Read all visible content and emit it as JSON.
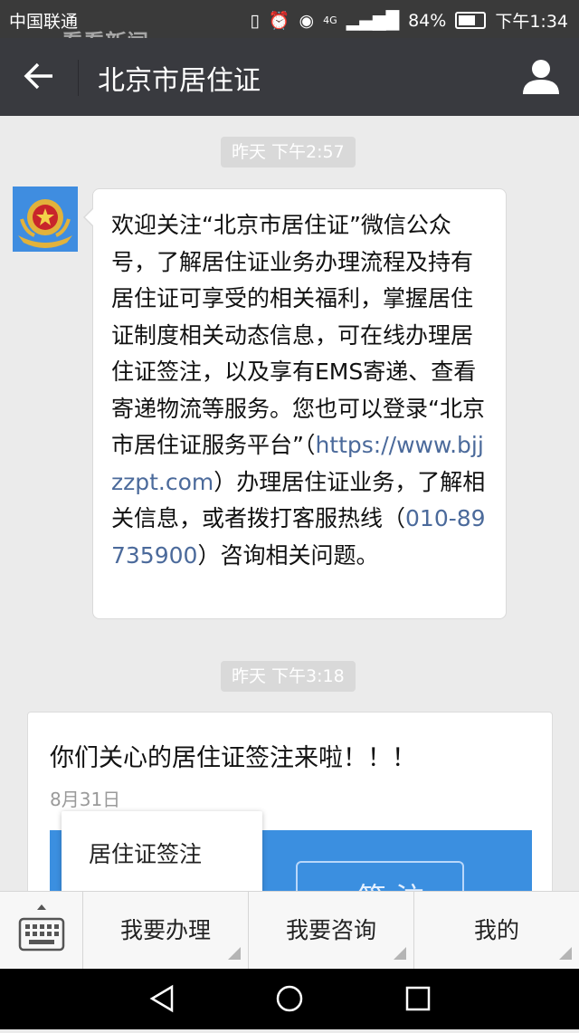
{
  "status_bar": {
    "carrier": "中国联通",
    "watermark": "看看新闻",
    "network": "4G",
    "battery": "84%",
    "battery_level": 0.84,
    "time": "下午1:34"
  },
  "header": {
    "title": "北京市居住证",
    "icons": [
      "back-arrow-icon",
      "profile-icon"
    ]
  },
  "messages": [
    {
      "timestamp": "昨天 下午2:57",
      "text_parts": [
        "欢迎关注“北京市居住证”微信公众号，了解居住证业务办理流程及持有居住证可享受的相关福利，掌握居住证制度相关动态信息，可在线办理居住证签注，以及享有EMS寄递、查看寄递物流等服务。您也可以登录“北京市居住证服务平台”（",
        "https://www.bjjzzpt.com",
        "）办理居住证业务，了解相关信息，或者拨打客服热线（",
        "010-89735900",
        "）咨询相关问题。"
      ]
    },
    {
      "timestamp": "昨天 下午3:18",
      "card_title": "你们关心的居住证签注来啦！！！",
      "card_date": "8月31日",
      "card_image_text": "签 注"
    }
  ],
  "popup_menu": {
    "items": [
      "居住证签注"
    ]
  },
  "bottom_menu": {
    "items": [
      "我要办理",
      "我要咨询",
      "我的"
    ]
  },
  "colors": {
    "header_bg": "#393a3f",
    "chat_bg": "#ebebeb",
    "link": "#4b6a9b",
    "card_image": "#3b8fe0"
  }
}
